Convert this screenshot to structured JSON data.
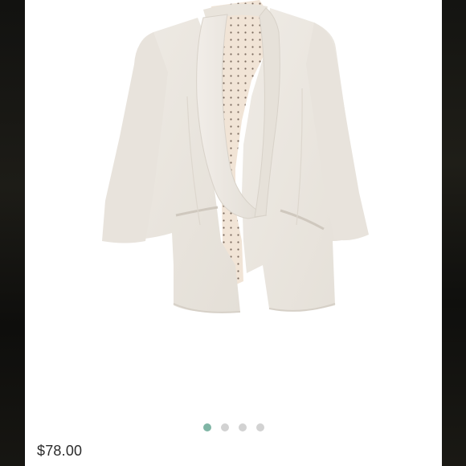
{
  "product": {
    "price": "$78.00",
    "image_icon": "blazer-photo"
  },
  "carousel": {
    "total_pages": 4,
    "active_page": 1,
    "active_color": "#7fb5a5",
    "inactive_color": "#d2d2d2"
  },
  "colors": {
    "card_background": "#ffffff",
    "blazer": "#ece8e2",
    "lining": "#f1e4d6"
  }
}
